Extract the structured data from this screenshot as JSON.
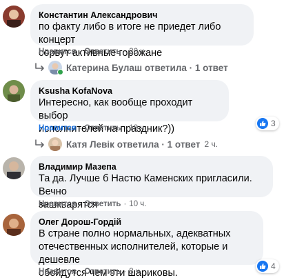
{
  "comments": [
    {
      "author": "Константин Александрович",
      "lines": [
        "по факту либо в итоге не приедет либо концерт",
        "сорвут активные горожане"
      ],
      "like": "Нравится",
      "reply": "Ответить",
      "time": "20 ч."
    },
    {
      "author": "Ksusha KofaNova",
      "lines": [
        "Интересно, как вообще проходит выбор",
        "исполнителей на праздник?))"
      ],
      "like": "Нравится",
      "reply": "Ответить",
      "time": "18 ч.",
      "reactions": "3"
    },
    {
      "author": "Владимир Мазепа",
      "lines": [
        "Та да. Лучше б Настю Каменских пригласили. Вечно",
        "зашкварятся"
      ],
      "like": "Нравится",
      "reply": "Ответить",
      "time": "10 ч."
    },
    {
      "author": "Олег Дорош-Гордій",
      "lines": [
        "В стране полно нормальных, адекватных",
        "отечественных исполнителей, которые и дешевле",
        "обойдутся чем эти шариковы."
      ],
      "like": "Нравится",
      "reply": "Ответить",
      "time": "8 ч.",
      "reactions": "4"
    }
  ],
  "replies": [
    {
      "text": "Катерина Булаш ответила · 1 ответ",
      "time": ""
    },
    {
      "text": "Катя Левік ответила · 1 ответ",
      "time": "2 ч."
    }
  ],
  "icons": {
    "reply_arrow": "reply-arrow-icon",
    "like": "thumbs-up-icon"
  },
  "colors": {
    "bubble": "#f0f2f5",
    "meta": "#65676b",
    "like_blue": "#1b74e4",
    "online_green": "#31a24c"
  }
}
